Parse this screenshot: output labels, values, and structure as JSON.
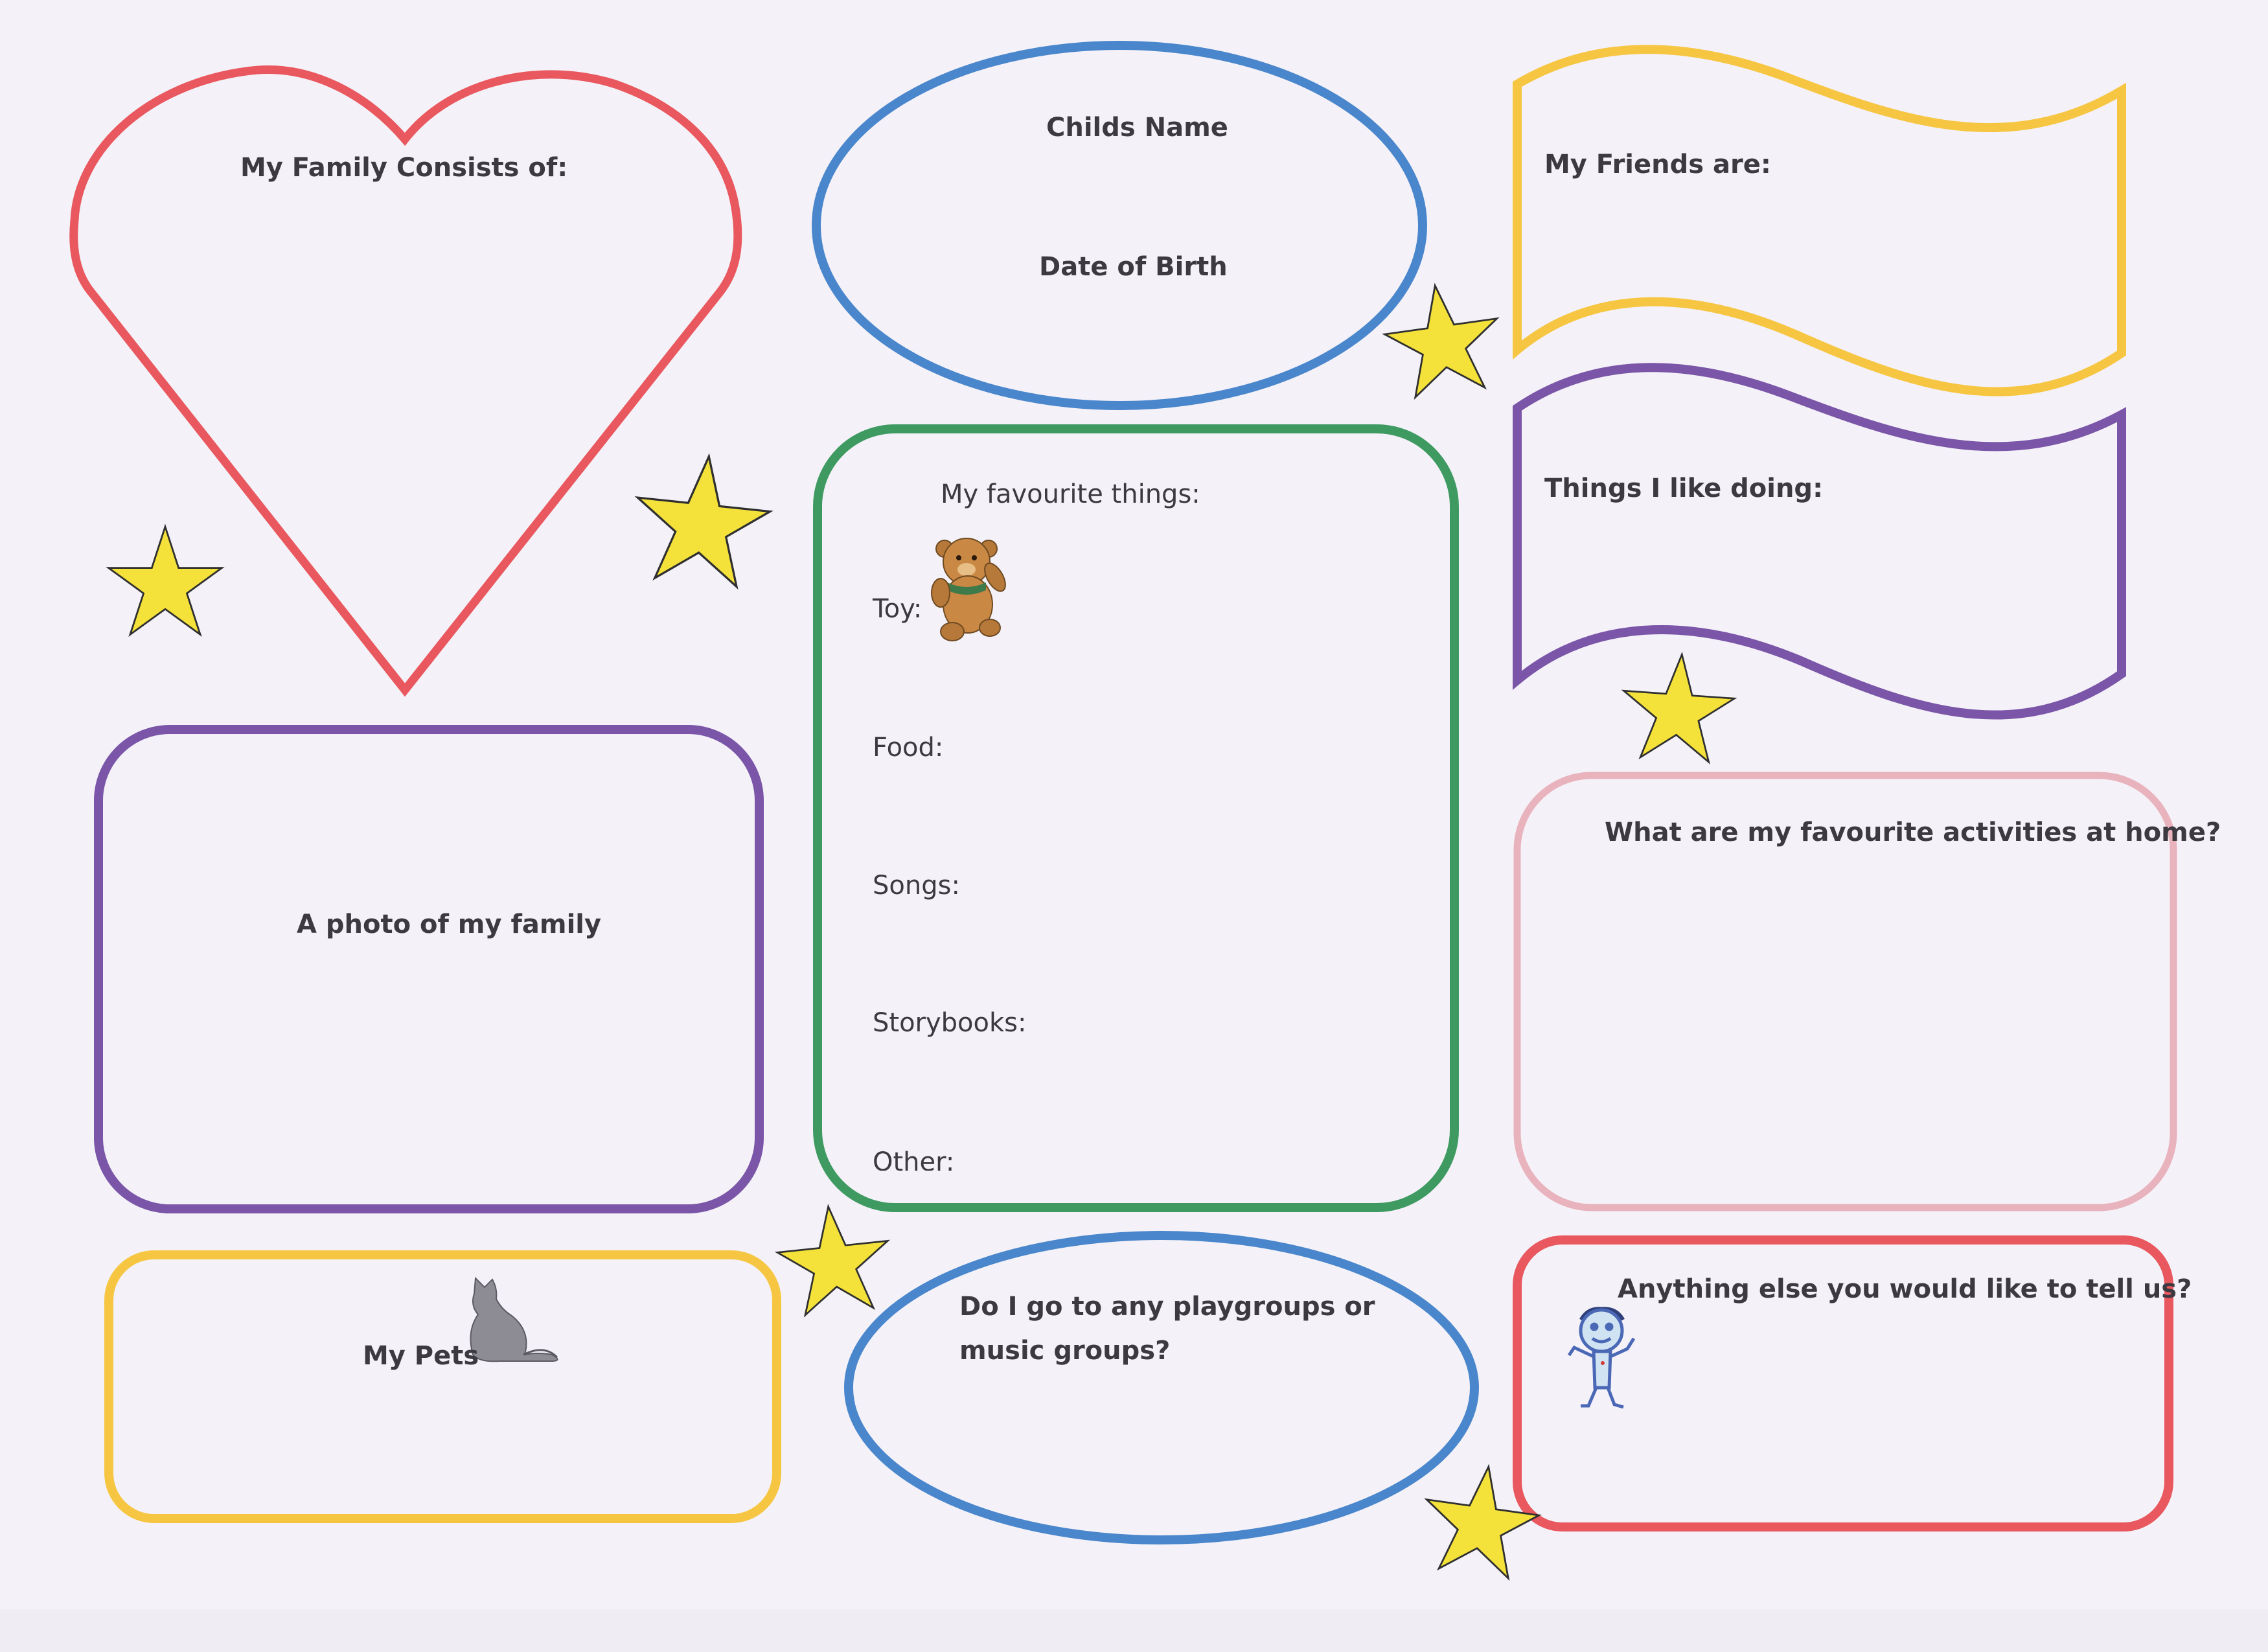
{
  "family": {
    "label": "My Family Consists of:"
  },
  "child": {
    "name_label": "Childs Name",
    "dob_label": "Date of Birth"
  },
  "friends": {
    "label": "My Friends are:"
  },
  "things": {
    "label": "Things I like doing:"
  },
  "favourites": {
    "title": "My favourite things:",
    "items": [
      "Toy:",
      "Food:",
      "Songs:",
      "Storybooks:",
      "Other:"
    ]
  },
  "photo": {
    "label": "A photo of my family"
  },
  "activities": {
    "label": "What are my favourite activities at home?"
  },
  "pets": {
    "label": "My Pets"
  },
  "playgroups": {
    "line1": "Do I go to any playgroups or",
    "line2": "music  groups?"
  },
  "anything_else": {
    "label": "Anything else you would like to tell us?"
  },
  "colors": {
    "red": "#e8585e",
    "blue": "#4a86cc",
    "yellow": "#f6c643",
    "purple": "#7a55a8",
    "green": "#3f9a62",
    "pink": "#e9b3bd",
    "star": "#f4e23b"
  }
}
